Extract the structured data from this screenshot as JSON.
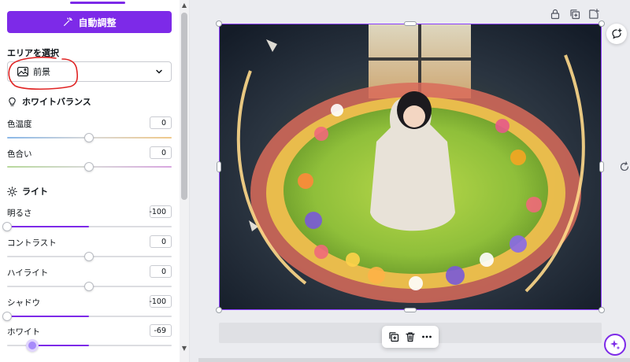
{
  "panel": {
    "auto_adjust_label": "自動調整",
    "area_heading": "エリアを選択",
    "area_select_value": "前景",
    "white_balance": {
      "heading": "ホワイトバランス",
      "rows": [
        {
          "label": "色温度",
          "value": "0"
        },
        {
          "label": "色合い",
          "value": "0"
        }
      ]
    },
    "light": {
      "heading": "ライト",
      "rows": [
        {
          "label": "明るさ",
          "value": "-100"
        },
        {
          "label": "コントラスト",
          "value": "0"
        },
        {
          "label": "ハイライト",
          "value": "0"
        },
        {
          "label": "シャドウ",
          "value": "-100"
        },
        {
          "label": "ホワイト",
          "value": "-69"
        }
      ]
    }
  },
  "colors": {
    "accent": "#7d2ae8",
    "selection": "#8b3dff",
    "annotation": "#e02424"
  },
  "icons": {
    "auto_adjust": "magic-wand-icon",
    "area_select": "image-icon",
    "white_balance": "lightbulb-icon",
    "light": "sun-icon",
    "lock": "lock-icon",
    "duplicate": "duplicate-icon",
    "add_page": "add-page-icon",
    "comment": "comment-add-icon",
    "rotate": "rotate-icon",
    "delete": "trash-icon",
    "more": "more-icon",
    "magic": "magic-sparkle-icon"
  }
}
